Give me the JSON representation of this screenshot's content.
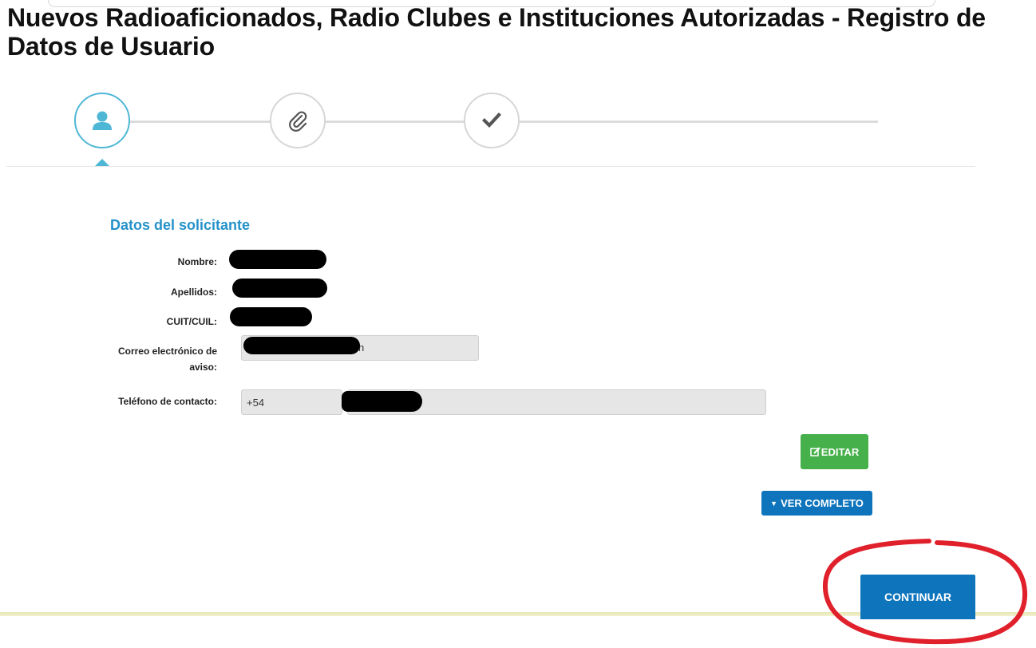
{
  "page": {
    "title": "Nuevos Radioaficionados, Radio Clubes e Instituciones Autorizadas - Registro de Datos de Usuario"
  },
  "steps": [
    {
      "icon": "user-icon",
      "state": "active"
    },
    {
      "icon": "paperclip-icon",
      "state": "pending"
    },
    {
      "icon": "check-icon",
      "state": "pending"
    }
  ],
  "form": {
    "section_title": "Datos del solicitante",
    "labels": {
      "nombre": "Nombre:",
      "apellidos": "Apellidos:",
      "cuit": "CUIT/CUIL:",
      "correo_line1": "Correo electrónico de",
      "correo_line2": "aviso:",
      "telefono": "Teléfono de contacto:"
    },
    "email_suffix_visible": "n",
    "phone_prefix": "+54"
  },
  "buttons": {
    "edit": "EDITAR",
    "more": "VER COMPLETO",
    "continue": "CONTINUAR"
  },
  "colors": {
    "accent_blue": "#0e75bd",
    "section_blue": "#2592c9",
    "active_step": "#4fb7d6",
    "edit_green": "#46b04a",
    "annotation_red": "#e0202a"
  }
}
